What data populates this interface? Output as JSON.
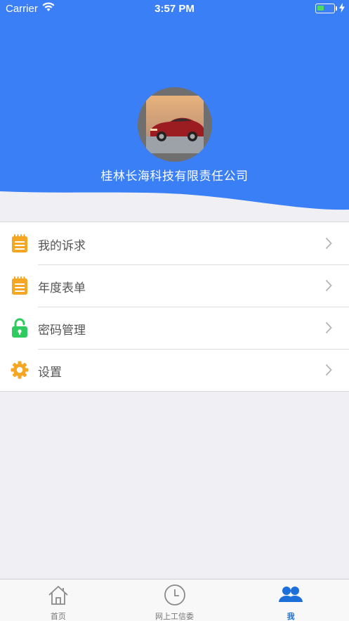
{
  "status_bar": {
    "carrier": "Carrier",
    "time": "3:57 PM"
  },
  "profile": {
    "company_name": "桂林长海科技有限责任公司"
  },
  "menu": {
    "items": [
      {
        "label": "我的诉求",
        "icon": "notepad-icon"
      },
      {
        "label": "年度表单",
        "icon": "notepad-icon"
      },
      {
        "label": "密码管理",
        "icon": "unlocked-padlock-icon"
      },
      {
        "label": "设置",
        "icon": "gear-icon"
      }
    ]
  },
  "tabbar": {
    "tabs": [
      {
        "label": "首页",
        "icon": "home-icon",
        "active": false
      },
      {
        "label": "网上工信委",
        "icon": "clock-icon",
        "active": false
      },
      {
        "label": "我",
        "icon": "users-icon",
        "active": true
      }
    ]
  },
  "colors": {
    "header_blue": "#3a7ff6",
    "accent_orange": "#f5a623",
    "lock_green": "#2ecc5f",
    "active_tab": "#1c6fd9"
  }
}
